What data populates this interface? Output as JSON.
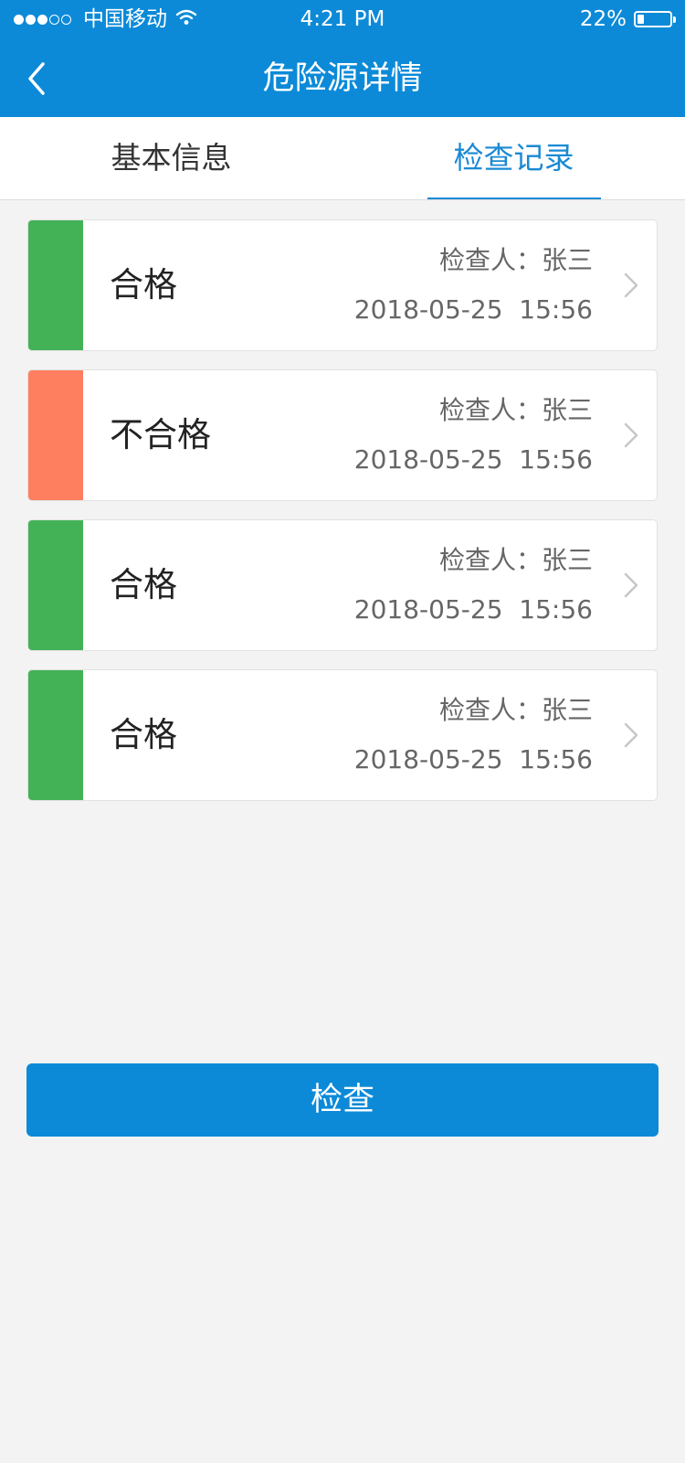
{
  "status_bar": {
    "carrier": "中国移动",
    "time": "4:21 PM",
    "battery_percent": "22%",
    "battery_level": 0.22,
    "signal_full": 3,
    "signal_total": 5
  },
  "nav": {
    "title": "危险源详情",
    "back_icon": "chevron-left-icon"
  },
  "tabs": [
    {
      "label": "基本信息",
      "active": false
    },
    {
      "label": "检查记录",
      "active": true
    }
  ],
  "records": [
    {
      "status": "合格",
      "inspector": "检查人：张三",
      "datetime": "2018-05-25  15:56",
      "color": "#43b257"
    },
    {
      "status": "不合格",
      "inspector": "检查人：张三",
      "datetime": "2018-05-25  15:56",
      "color": "#fd7f60"
    },
    {
      "status": "合格",
      "inspector": "检查人：张三",
      "datetime": "2018-05-25  15:56",
      "color": "#43b257"
    },
    {
      "status": "合格",
      "inspector": "检查人：张三",
      "datetime": "2018-05-25  15:56",
      "color": "#43b257"
    }
  ],
  "action_button": {
    "label": "检查"
  },
  "colors": {
    "primary": "#0c8ad8",
    "tab_active": "#1a8ad4",
    "pass": "#43b257",
    "fail": "#fd7f60",
    "background": "#f3f3f3"
  }
}
